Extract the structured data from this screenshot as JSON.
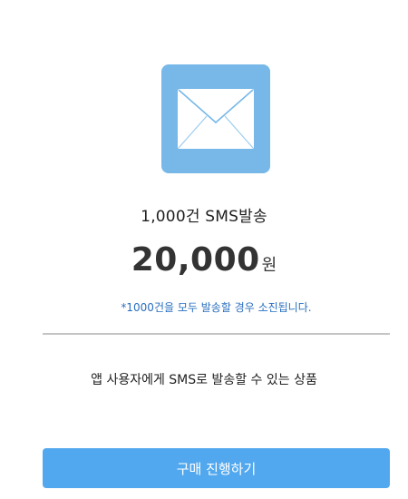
{
  "product": {
    "icon": "envelope-icon",
    "icon_bg_color": "#77b8e8",
    "name": "1,000건 SMS발송",
    "price_value": "20,000",
    "price_unit": "원",
    "notice": "*1000건을 모두 발송할 경우 소진됩니다.",
    "description": "앱 사용자에게 SMS로 발송할 수 있는 상품"
  },
  "actions": {
    "purchase_label": "구매 진행하기",
    "button_color": "#52a8ee"
  }
}
